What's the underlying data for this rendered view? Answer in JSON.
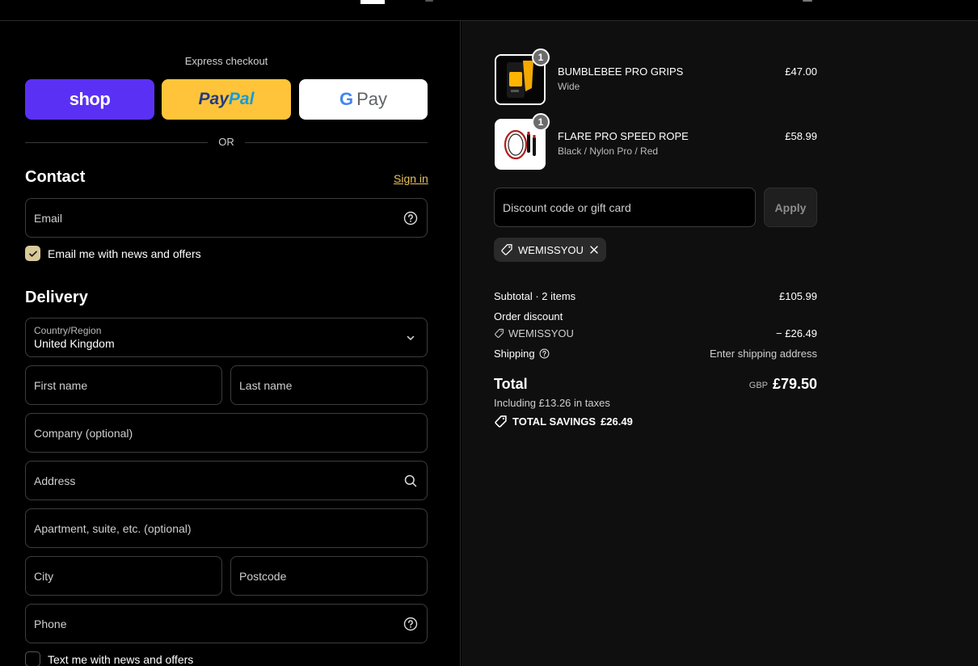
{
  "express": {
    "label": "Express checkout",
    "shop_label": "shop",
    "paypal_part1": "Pay",
    "paypal_part2": "Pal",
    "gpay_g": "G",
    "gpay_label": "Pay",
    "or_label": "OR"
  },
  "contact": {
    "title": "Contact",
    "sign_in": "Sign in",
    "email_placeholder": "Email",
    "news_label": "Email me with news and offers",
    "news_checked": true
  },
  "delivery": {
    "title": "Delivery",
    "country_label": "Country/Region",
    "country_value": "United Kingdom",
    "first_name": "First name",
    "last_name": "Last name",
    "company": "Company (optional)",
    "address": "Address",
    "apartment": "Apartment, suite, etc. (optional)",
    "city": "City",
    "postcode": "Postcode",
    "phone": "Phone",
    "text_label": "Text me with news and offers",
    "text_checked": false
  },
  "cart": {
    "items": [
      {
        "name": "BUMBLEBEE PRO GRIPS",
        "variant": "Wide",
        "price": "£47.00",
        "qty": "1"
      },
      {
        "name": "FLARE PRO SPEED ROPE",
        "variant": "Black / Nylon Pro / Red",
        "price": "£58.99",
        "qty": "1"
      }
    ],
    "discount_placeholder": "Discount code or gift card",
    "apply_label": "Apply",
    "code": "WEMISSYOU"
  },
  "summary": {
    "subtotal_label": "Subtotal · 2 items",
    "subtotal_value": "£105.99",
    "order_discount_label": "Order discount",
    "discount_code": "WEMISSYOU",
    "discount_value": "− £26.49",
    "shipping_label": "Shipping",
    "shipping_value": "Enter shipping address",
    "total_label": "Total",
    "currency": "GBP",
    "total_value": "£79.50",
    "tax_note": "Including £13.26 in taxes",
    "savings_label": "TOTAL SAVINGS",
    "savings_value": "£26.49"
  },
  "colors": {
    "shop": "#5a31f4",
    "paypal": "#ffc439",
    "sign_in": "#e8c25a",
    "checkbox_on": "#d9c99a"
  }
}
